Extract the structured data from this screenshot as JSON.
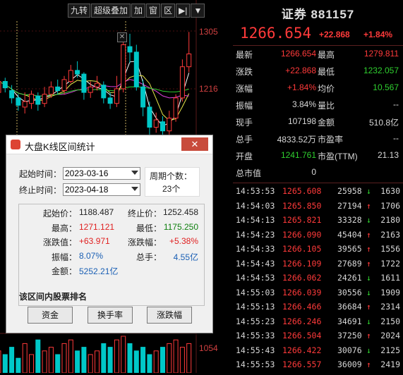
{
  "toolbar": {
    "items": [
      "九转",
      "超级叠加",
      "加",
      "窗",
      "区",
      "▶|",
      "▼"
    ]
  },
  "chart": {
    "price_ticks": [
      "1305",
      "1216",
      "1054"
    ],
    "candles": [
      {
        "o": 1238,
        "c": 1250,
        "h": 1256,
        "l": 1232,
        "up": true
      },
      {
        "o": 1250,
        "c": 1243,
        "h": 1254,
        "l": 1238,
        "up": false
      },
      {
        "o": 1240,
        "c": 1232,
        "h": 1246,
        "l": 1226,
        "up": false
      },
      {
        "o": 1232,
        "c": 1224,
        "h": 1236,
        "l": 1218,
        "up": false
      },
      {
        "o": 1222,
        "c": 1228,
        "h": 1238,
        "l": 1215,
        "up": true
      },
      {
        "o": 1226,
        "c": 1236,
        "h": 1240,
        "l": 1220,
        "up": true
      },
      {
        "o": 1234,
        "c": 1225,
        "h": 1238,
        "l": 1218,
        "up": false
      },
      {
        "o": 1226,
        "c": 1236,
        "h": 1244,
        "l": 1222,
        "up": true
      },
      {
        "o": 1236,
        "c": 1244,
        "h": 1250,
        "l": 1232,
        "up": true
      },
      {
        "o": 1244,
        "c": 1240,
        "h": 1252,
        "l": 1236,
        "up": false
      },
      {
        "o": 1240,
        "c": 1252,
        "h": 1256,
        "l": 1236,
        "up": true
      },
      {
        "o": 1250,
        "c": 1262,
        "h": 1268,
        "l": 1248,
        "up": true
      },
      {
        "o": 1262,
        "c": 1258,
        "h": 1272,
        "l": 1254,
        "up": false
      },
      {
        "o": 1258,
        "c": 1238,
        "h": 1260,
        "l": 1230,
        "up": false
      },
      {
        "o": 1238,
        "c": 1244,
        "h": 1250,
        "l": 1232,
        "up": true
      },
      {
        "o": 1244,
        "c": 1248,
        "h": 1256,
        "l": 1240,
        "up": true
      },
      {
        "o": 1246,
        "c": 1232,
        "h": 1250,
        "l": 1226,
        "up": false
      },
      {
        "o": 1232,
        "c": 1226,
        "h": 1238,
        "l": 1220,
        "up": false
      },
      {
        "o": 1226,
        "c": 1242,
        "h": 1256,
        "l": 1222,
        "up": true
      },
      {
        "o": 1242,
        "c": 1290,
        "h": 1298,
        "l": 1238,
        "up": true
      },
      {
        "o": 1288,
        "c": 1282,
        "h": 1302,
        "l": 1270,
        "up": false
      },
      {
        "o": 1282,
        "c": 1244,
        "h": 1290,
        "l": 1240,
        "up": false
      },
      {
        "o": 1244,
        "c": 1222,
        "h": 1252,
        "l": 1212,
        "up": false
      },
      {
        "o": 1222,
        "c": 1200,
        "h": 1228,
        "l": 1190,
        "up": false
      },
      {
        "o": 1200,
        "c": 1208,
        "h": 1216,
        "l": 1194,
        "up": true
      },
      {
        "o": 1206,
        "c": 1196,
        "h": 1212,
        "l": 1190,
        "up": false
      },
      {
        "o": 1196,
        "c": 1210,
        "h": 1218,
        "l": 1192,
        "up": true
      },
      {
        "o": 1210,
        "c": 1232,
        "h": 1236,
        "l": 1206,
        "up": true
      },
      {
        "o": 1232,
        "c": 1266,
        "h": 1274,
        "l": 1228,
        "up": true
      },
      {
        "o": 1266,
        "c": 1280,
        "h": 1304,
        "l": 1260,
        "up": true
      }
    ],
    "volumes": [
      0.6,
      0.5,
      0.7,
      0.4,
      0.8,
      0.5,
      0.9,
      0.6,
      0.7,
      0.5,
      0.8,
      0.9,
      0.6,
      0.7,
      0.5,
      0.6,
      0.8,
      0.7,
      0.9,
      1.0,
      0.8,
      0.6,
      0.7,
      0.5,
      0.6,
      0.7,
      0.8,
      0.9,
      0.7,
      0.8
    ]
  },
  "quote": {
    "title": "证券 881157",
    "price": "1266.654",
    "change": "+22.868",
    "change_pct": "+1.84%",
    "rows": [
      {
        "l1": "最新",
        "v1": "1266.654",
        "c1": "red",
        "l2": "最高",
        "v2": "1279.811",
        "c2": "red"
      },
      {
        "l1": "涨跌",
        "v1": "+22.868",
        "c1": "red",
        "l2": "最低",
        "v2": "1232.057",
        "c2": "green"
      },
      {
        "l1": "涨幅",
        "v1": "+1.84%",
        "c1": "red",
        "l2": "均价",
        "v2": "10.567",
        "c2": "green"
      },
      {
        "l1": "振幅",
        "v1": "3.84%",
        "c1": "white",
        "l2": "量比",
        "v2": "--",
        "c2": "white"
      },
      {
        "l1": "现手",
        "v1": "107198",
        "c1": "white",
        "l2": "金额",
        "v2": "510.8亿",
        "c2": "white"
      },
      {
        "l1": "总手",
        "v1": "4833.52万",
        "c1": "white",
        "l2": "市盈率",
        "v2": "--",
        "c2": "white"
      },
      {
        "l1": "开盘",
        "v1": "1241.761",
        "c1": "green",
        "l2": "市盈(TTM)",
        "v2": "21.13",
        "c2": "white"
      },
      {
        "l1": "总市值",
        "v1": "0",
        "c1": "white",
        "l2": "",
        "v2": "",
        "c2": "white"
      }
    ],
    "ticks": [
      {
        "time": "14:53:53",
        "price": "1265.608",
        "vol": "25958",
        "arrow": "↓",
        "n": "1630",
        "dir": "down"
      },
      {
        "time": "14:54:03",
        "price": "1265.850",
        "vol": "27194",
        "arrow": "↑",
        "n": "1706",
        "dir": "up"
      },
      {
        "time": "14:54:13",
        "price": "1265.821",
        "vol": "33328",
        "arrow": "↓",
        "n": "2180",
        "dir": "down"
      },
      {
        "time": "14:54:23",
        "price": "1266.090",
        "vol": "45404",
        "arrow": "↑",
        "n": "2163",
        "dir": "up"
      },
      {
        "time": "14:54:33",
        "price": "1266.105",
        "vol": "39565",
        "arrow": "↑",
        "n": "1556",
        "dir": "up"
      },
      {
        "time": "14:54:43",
        "price": "1266.109",
        "vol": "27689",
        "arrow": "↑",
        "n": "1722",
        "dir": "up"
      },
      {
        "time": "14:54:53",
        "price": "1266.062",
        "vol": "24261",
        "arrow": "↓",
        "n": "1611",
        "dir": "down"
      },
      {
        "time": "14:55:03",
        "price": "1266.039",
        "vol": "30556",
        "arrow": "↓",
        "n": "1909",
        "dir": "down"
      },
      {
        "time": "14:55:13",
        "price": "1266.466",
        "vol": "36684",
        "arrow": "↑",
        "n": "2314",
        "dir": "up"
      },
      {
        "time": "14:55:23",
        "price": "1266.246",
        "vol": "34691",
        "arrow": "↓",
        "n": "2150",
        "dir": "down"
      },
      {
        "time": "14:55:33",
        "price": "1266.504",
        "vol": "37250",
        "arrow": "↑",
        "n": "2024",
        "dir": "up"
      },
      {
        "time": "14:55:43",
        "price": "1266.422",
        "vol": "30076",
        "arrow": "↓",
        "n": "2125",
        "dir": "down"
      },
      {
        "time": "14:55:53",
        "price": "1266.557",
        "vol": "36009",
        "arrow": "↑",
        "n": "2419",
        "dir": "up"
      }
    ]
  },
  "dialog": {
    "title": "大盘K线区间统计",
    "start_label": "起始时间：",
    "start_value": "2023-03-16",
    "end_label": "终止时间：",
    "end_value": "2023-04-18",
    "period_label": "周期个数：",
    "period_value": "23个",
    "stats": [
      {
        "l1": "起始价：",
        "v1": "1188.487",
        "c1": "#222",
        "l2": "终止价：",
        "v2": "1252.458",
        "c2": "#222"
      },
      {
        "l1": "最高：",
        "v1": "1271.121",
        "c1": "#e02020",
        "l2": "最低：",
        "v2": "1175.250",
        "c2": "#108010"
      },
      {
        "l1": "涨跌值：",
        "v1": "+63.971",
        "c1": "#e02020",
        "l2": "涨跌幅：",
        "v2": "+5.38%",
        "c2": "#e02020"
      },
      {
        "l1": "振幅：",
        "v1": "8.07%",
        "c1": "#1a5fb4",
        "l2": "总手：",
        "v2": "4.55亿",
        "c2": "#1a5fb4"
      },
      {
        "l1": "金额：",
        "v1": "5252.21亿",
        "c1": "#1a5fb4",
        "l2": "",
        "v2": "",
        "c2": "#222"
      }
    ],
    "section_label": "该区间内股票排名",
    "buttons": [
      "资金",
      "换手率",
      "涨跌幅"
    ]
  },
  "colors": {
    "up": "#ff3a3a",
    "down": "#00c8c8",
    "ma1": "#ffffff",
    "ma2": "#e8e84a",
    "ma3": "#e040e0",
    "ma4": "#30d030"
  }
}
